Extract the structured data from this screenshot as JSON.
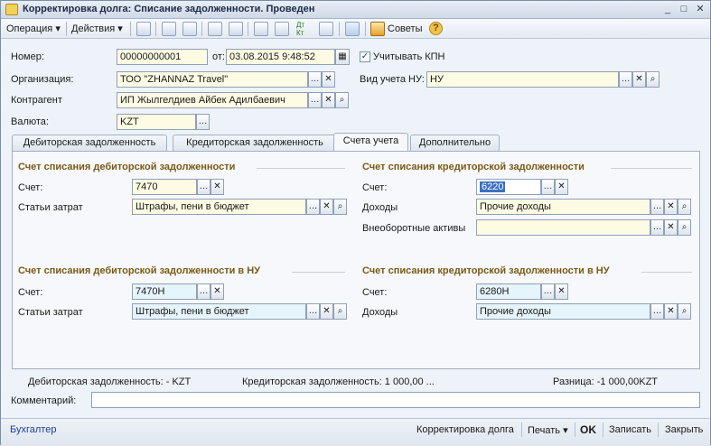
{
  "window": {
    "title": "Корректировка долга: Списание задолженности. Проведен",
    "controls": {
      "minimize": "_",
      "maximize": "□",
      "close": "✕"
    }
  },
  "toolbar": {
    "operation_label": "Операция",
    "actions_label": "Действия",
    "tips_label": "Советы",
    "help_icon_text": "?",
    "dtkt_text": "Дт Кт"
  },
  "header": {
    "number_label": "Номер:",
    "number_value": "00000000001",
    "date_label": "от:",
    "date_value": "03.08.2015  9:48:52",
    "kpn_label": "Учитывать КПН",
    "kpn_checked": true,
    "org_label": "Организация:",
    "org_value": "ТОО  \"ZHANNAZ Travel\"",
    "nu_label": "Вид учета НУ:",
    "nu_value": "НУ",
    "contractor_label": "Контрагент",
    "contractor_value": "ИП Жылгелдиев Айбек Адилбаевич",
    "currency_label": "Валюта:",
    "currency_value": "KZT"
  },
  "tabs": [
    {
      "label": "Дебиторская задолженность"
    },
    {
      "label": "Кредиторская задолженность"
    },
    {
      "label": "Счета учета"
    },
    {
      "label": "Дополнительно"
    }
  ],
  "panel": {
    "debit_title": "Счет списания дебиторской задолженности",
    "debit_account_label": "Счет:",
    "debit_account_value": "7470",
    "debit_cost_label": "Статьи затрат",
    "debit_cost_value": "Штрафы, пени в бюджет",
    "credit_title": "Счет списания кредиторской задолженности",
    "credit_account_label": "Счет:",
    "credit_account_value": "6220",
    "credit_income_label": "Доходы",
    "credit_income_value": "Прочие доходы",
    "credit_assets_label": "Внеоборотные активы",
    "credit_assets_value": "",
    "debit_nu_title": "Счет списания дебиторской задолженности в НУ",
    "debit_nu_account_label": "Счет:",
    "debit_nu_account_value": "7470Н",
    "debit_nu_cost_label": "Статьи затрат",
    "debit_nu_cost_value": "Штрафы, пени в бюджет",
    "credit_nu_title": "Счет списания кредиторской задолженности в НУ",
    "credit_nu_account_label": "Счет:",
    "credit_nu_account_value": "6280Н",
    "credit_nu_income_label": "Доходы",
    "credit_nu_income_value": "Прочие доходы"
  },
  "summary": {
    "debit": "Дебиторская задолженность: - KZT",
    "credit": "Кредиторская задолженность: 1 000,00 ...",
    "difference": "Разница: -1 000,00KZT",
    "comment_label": "Комментарий:",
    "comment_value": ""
  },
  "statusbar": {
    "user": "Бухгалтер",
    "debt_adjust": "Корректировка долга",
    "print": "Печать",
    "ok": "OK",
    "save": "Записать",
    "close": "Закрыть"
  },
  "colors": {
    "section_title": "#7a5a14",
    "field_yellow": "#fdfbe3",
    "field_blue": "#e6f4fb",
    "selection": "#3b6fc4"
  }
}
